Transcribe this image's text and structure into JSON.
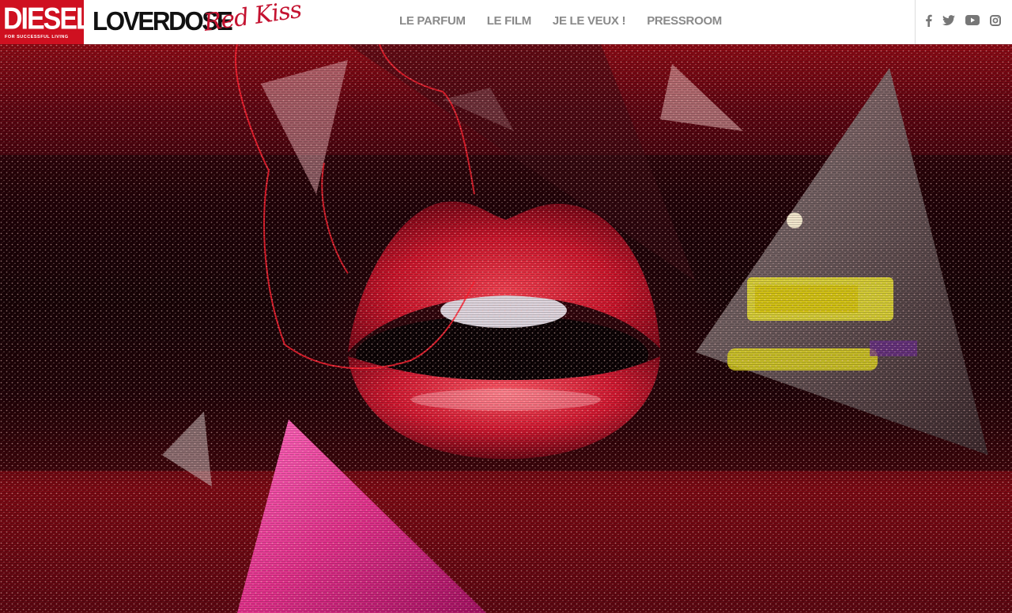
{
  "brand": {
    "logo": "DIESEL",
    "logo_tagline": "FOR SUCCESSFUL LIVING",
    "title": "LOVERDOSE",
    "script": "Red Kiss"
  },
  "nav": {
    "items": [
      {
        "label": "LE PARFUM"
      },
      {
        "label": "LE FILM"
      },
      {
        "label": "JE LE VEUX !"
      },
      {
        "label": "PRESSROOM"
      }
    ]
  },
  "social": {
    "icons": [
      "facebook-icon",
      "twitter-icon",
      "youtube-icon",
      "instagram-icon"
    ]
  },
  "colors": {
    "brand_red": "#cf1020",
    "lip_red": "#d01830",
    "nav_gray": "#8a8a8a",
    "magenta": "#e0308a"
  }
}
